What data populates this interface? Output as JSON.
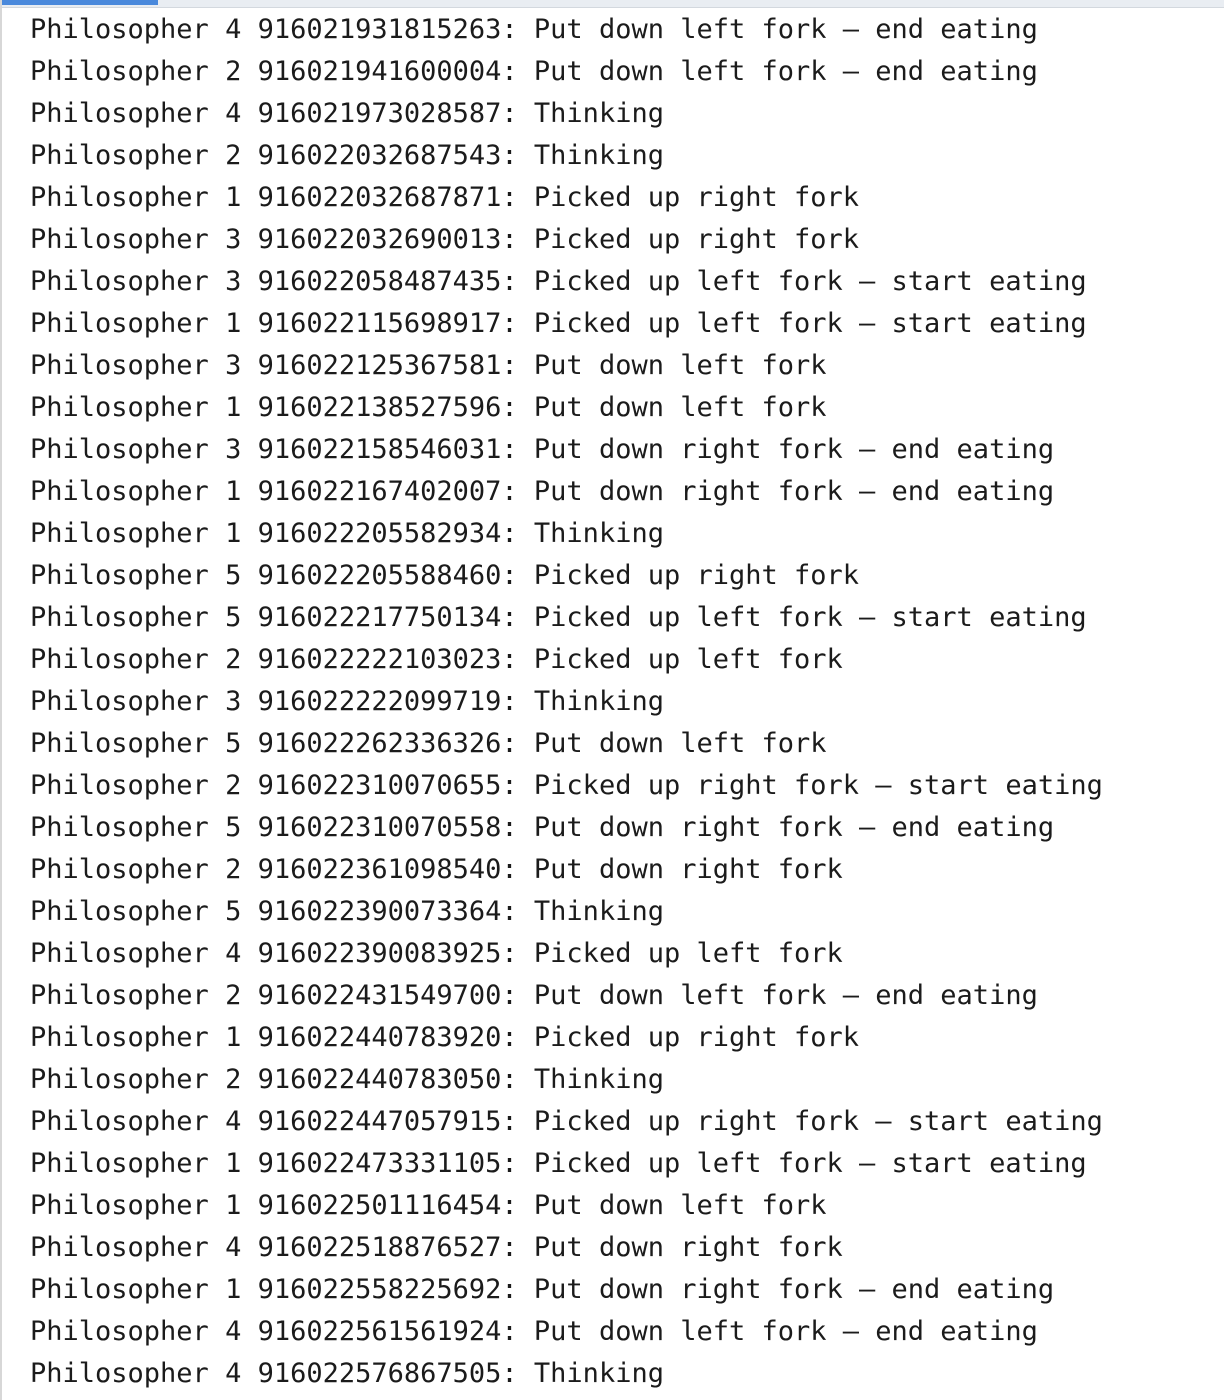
{
  "console": {
    "lines": [
      "Philosopher 4 916021931815263: Put down left fork – end eating",
      "Philosopher 2 916021941600004: Put down left fork – end eating",
      "Philosopher 4 916021973028587: Thinking",
      "Philosopher 2 916022032687543: Thinking",
      "Philosopher 1 916022032687871: Picked up right fork",
      "Philosopher 3 916022032690013: Picked up right fork",
      "Philosopher 3 916022058487435: Picked up left fork – start eating",
      "Philosopher 1 916022115698917: Picked up left fork – start eating",
      "Philosopher 3 916022125367581: Put down left fork",
      "Philosopher 1 916022138527596: Put down left fork",
      "Philosopher 3 916022158546031: Put down right fork – end eating",
      "Philosopher 1 916022167402007: Put down right fork – end eating",
      "Philosopher 1 916022205582934: Thinking",
      "Philosopher 5 916022205588460: Picked up right fork",
      "Philosopher 5 916022217750134: Picked up left fork – start eating",
      "Philosopher 2 916022222103023: Picked up left fork",
      "Philosopher 3 916022222099719: Thinking",
      "Philosopher 5 916022262336326: Put down left fork",
      "Philosopher 2 916022310070655: Picked up right fork – start eating",
      "Philosopher 5 916022310070558: Put down right fork – end eating",
      "Philosopher 2 916022361098540: Put down right fork",
      "Philosopher 5 916022390073364: Thinking",
      "Philosopher 4 916022390083925: Picked up left fork",
      "Philosopher 2 916022431549700: Put down left fork – end eating",
      "Philosopher 1 916022440783920: Picked up right fork",
      "Philosopher 2 916022440783050: Thinking",
      "Philosopher 4 916022447057915: Picked up right fork – start eating",
      "Philosopher 1 916022473331105: Picked up left fork – start eating",
      "Philosopher 1 916022501116454: Put down left fork",
      "Philosopher 4 916022518876527: Put down right fork",
      "Philosopher 1 916022558225692: Put down right fork – end eating",
      "Philosopher 4 916022561561924: Put down left fork – end eating",
      "Philosopher 4 916022576867505: Thinking"
    ]
  }
}
